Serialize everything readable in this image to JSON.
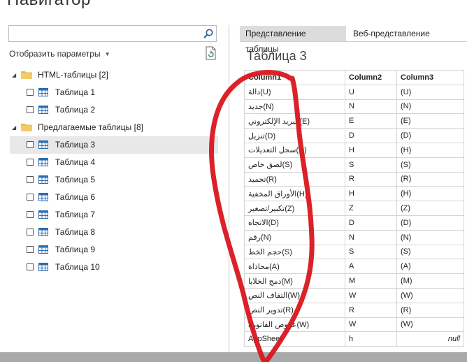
{
  "title": "Навигатор",
  "search": {
    "value": "",
    "placeholder": ""
  },
  "options_label": "Отобразить параметры",
  "groups": [
    {
      "label": "HTML-таблицы [2]",
      "items": [
        "Таблица 1",
        "Таблица 2"
      ]
    },
    {
      "label": "Предлагаемые таблицы [8]",
      "items": [
        "Таблица 3",
        "Таблица 4",
        "Таблица 5",
        "Таблица 6",
        "Таблица 7",
        "Таблица 8",
        "Таблица 9",
        "Таблица 10"
      ]
    }
  ],
  "selected_item": "Таблица 3",
  "tabs": [
    {
      "label": "Представление таблицы",
      "active": true
    },
    {
      "label": "Веб-представление",
      "active": false
    }
  ],
  "table_title": "Таблица 3",
  "table": {
    "columns": [
      "Column1",
      "Column2",
      "Column3"
    ],
    "rows": [
      [
        "دالة(U)",
        "U",
        "(U)"
      ],
      [
        "جديد(N)",
        "N",
        "(N)"
      ],
      [
        "البريد الإلكتروني(E)",
        "E",
        "(E)"
      ],
      [
        "تنزيل(D)",
        "D",
        "(D)"
      ],
      [
        "سجل التعديلات(H)",
        "H",
        "(H)"
      ],
      [
        "لصق خاص(S)",
        "S",
        "(S)"
      ],
      [
        "تجميد(R)",
        "R",
        "(R)"
      ],
      [
        "الأوراق المخفية(H)",
        "H",
        "(H)"
      ],
      [
        "تكبير/تصغير(Z)",
        "Z",
        "(Z)"
      ],
      [
        "الاتجاه(D)",
        "D",
        "(D)"
      ],
      [
        "رقم(N)",
        "N",
        "(N)"
      ],
      [
        "حجم الخط(S)",
        "S",
        "(S)"
      ],
      [
        "محاذاة(A)",
        "A",
        "(A)"
      ],
      [
        "دمج الخلايا(M)",
        "M",
        "(M)"
      ],
      [
        "التفاف النص(W)",
        "W",
        "(W)"
      ],
      [
        "تدوير النص(R)",
        "R",
        "(R)"
      ],
      [
        "عروض الفاتورة(W)",
        "W",
        "(W)"
      ],
      [
        "AppSheet",
        "h",
        "null"
      ]
    ]
  },
  "colors": {
    "annotation": "#d9161c",
    "selected_row": "#e8e8e8",
    "active_tab": "#dcdcdc",
    "folder": "#e9b949",
    "table_icon": "#2b6cb0"
  }
}
